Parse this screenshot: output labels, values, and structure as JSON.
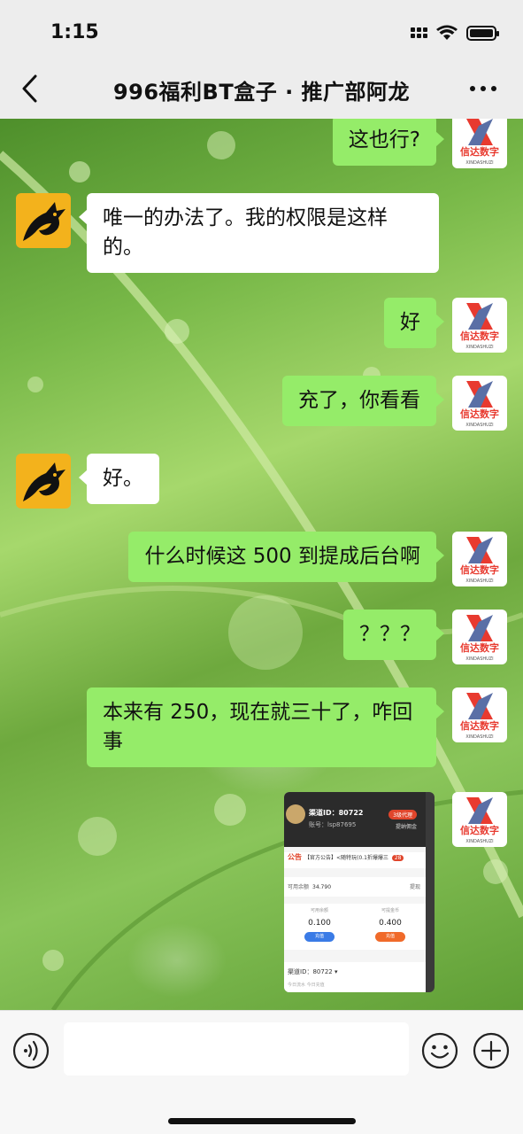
{
  "status": {
    "time": "1:15"
  },
  "header": {
    "title": "996福利BT盒子 · 推广部阿龙"
  },
  "avatars": {
    "left_text": "",
    "right_brand": "信达数字",
    "right_sub": "XINDASHUZI"
  },
  "messages": [
    {
      "side": "right",
      "text": "这也行?"
    },
    {
      "side": "left",
      "text": "唯一的办法了。我的权限是这样的。"
    },
    {
      "side": "right",
      "text": "好"
    },
    {
      "side": "right",
      "text": "充了，你看看"
    },
    {
      "side": "left",
      "text": "好。"
    },
    {
      "side": "right",
      "text": "什么时候这 500 到提成后台啊"
    },
    {
      "side": "right",
      "text": "？？？"
    },
    {
      "side": "right",
      "text": "本来有 250，现在就三十了，咋回事"
    }
  ],
  "image_message": {
    "channel": "渠道ID：80722",
    "account": "账号：lsp87695",
    "badge": "3级代理",
    "commission_link": "提纳佣金",
    "notice_label": "公告",
    "notice_text": "【官方公告】<随特玩(0.1折爆爆三",
    "notice_count": "28",
    "balance_label": "可用余额",
    "balance_value": "34.790",
    "withdraw": "提现",
    "card1_label": "可用余额",
    "card1_value": "0.100",
    "card1_btn": "充值",
    "card2_label": "可提金币",
    "card2_value": "0.400",
    "card2_btn": "充值",
    "footer_channel": "渠道ID：80722 ▾",
    "footer_sub": "今日流水          今日充值"
  },
  "input": {
    "placeholder": "",
    "value": ""
  },
  "colors": {
    "self_bubble": "#95ec69",
    "other_bubble": "#ffffff",
    "bar": "#ededed"
  }
}
